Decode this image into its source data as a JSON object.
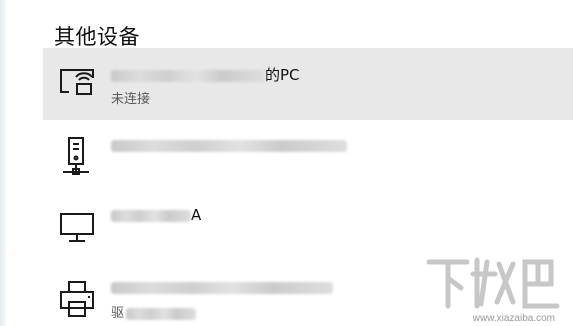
{
  "section": {
    "title": "其他设备"
  },
  "devices": [
    {
      "icon": "wireless-display-icon",
      "name_suffix": "的PC",
      "status": "未连接",
      "selected": true
    },
    {
      "icon": "network-device-icon",
      "name_suffix": "",
      "status": "",
      "selected": false
    },
    {
      "icon": "monitor-icon",
      "name_suffix": "A",
      "status": "",
      "selected": false
    },
    {
      "icon": "printer-icon",
      "name_suffix": "",
      "status": "驱",
      "selected": false
    }
  ],
  "watermark": {
    "url": "www.xiazaiba.com"
  },
  "colors": {
    "selected_bg": "#e8e8e8",
    "icon": "#1a1a1a",
    "background": "#ffffff"
  }
}
